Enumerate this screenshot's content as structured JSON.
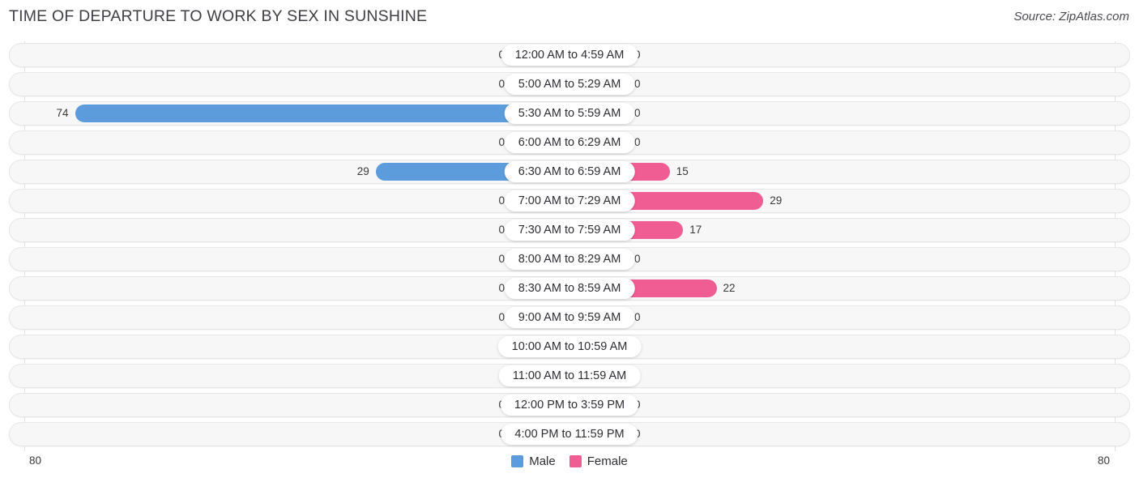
{
  "header": {
    "title": "TIME OF DEPARTURE TO WORK BY SEX IN SUNSHINE",
    "source": "Source: ZipAtlas.com"
  },
  "legend": {
    "male_label": "Male",
    "female_label": "Female",
    "male_color": "#5d9cdc",
    "female_color": "#ef5d93",
    "male_color_light": "#afcbee",
    "female_color_light": "#f9a8c3"
  },
  "axis": {
    "left_max_label": "80",
    "right_max_label": "80",
    "max": 80
  },
  "chart_data": {
    "type": "bar",
    "orientation": "horizontal-diverging",
    "title": "TIME OF DEPARTURE TO WORK BY SEX IN SUNSHINE",
    "xlabel": "",
    "ylabel": "",
    "xlim": [
      80,
      80
    ],
    "grid": false,
    "legend_position": "bottom-center",
    "categories": [
      "12:00 AM to 4:59 AM",
      "5:00 AM to 5:29 AM",
      "5:30 AM to 5:59 AM",
      "6:00 AM to 6:29 AM",
      "6:30 AM to 6:59 AM",
      "7:00 AM to 7:29 AM",
      "7:30 AM to 7:59 AM",
      "8:00 AM to 8:29 AM",
      "8:30 AM to 8:59 AM",
      "9:00 AM to 9:59 AM",
      "10:00 AM to 10:59 AM",
      "11:00 AM to 11:59 AM",
      "12:00 PM to 3:59 PM",
      "4:00 PM to 11:59 PM"
    ],
    "series": [
      {
        "name": "Male",
        "values": [
          0,
          0,
          74,
          0,
          29,
          0,
          0,
          0,
          0,
          0,
          0,
          0,
          0,
          0
        ]
      },
      {
        "name": "Female",
        "values": [
          0,
          0,
          0,
          0,
          15,
          29,
          17,
          0,
          22,
          0,
          0,
          0,
          0,
          0
        ]
      }
    ]
  },
  "rows": [
    {
      "label": "12:00 AM to 4:59 AM",
      "male": "0",
      "female": "0"
    },
    {
      "label": "5:00 AM to 5:29 AM",
      "male": "0",
      "female": "0"
    },
    {
      "label": "5:30 AM to 5:59 AM",
      "male": "74",
      "female": "0"
    },
    {
      "label": "6:00 AM to 6:29 AM",
      "male": "0",
      "female": "0"
    },
    {
      "label": "6:30 AM to 6:59 AM",
      "male": "29",
      "female": "15"
    },
    {
      "label": "7:00 AM to 7:29 AM",
      "male": "0",
      "female": "29"
    },
    {
      "label": "7:30 AM to 7:59 AM",
      "male": "0",
      "female": "17"
    },
    {
      "label": "8:00 AM to 8:29 AM",
      "male": "0",
      "female": "0"
    },
    {
      "label": "8:30 AM to 8:59 AM",
      "male": "0",
      "female": "22"
    },
    {
      "label": "9:00 AM to 9:59 AM",
      "male": "0",
      "female": "0"
    },
    {
      "label": "10:00 AM to 10:59 AM",
      "male": "0",
      "female": "0"
    },
    {
      "label": "11:00 AM to 11:59 AM",
      "male": "0",
      "female": "0"
    },
    {
      "label": "12:00 PM to 3:59 PM",
      "male": "0",
      "female": "0"
    },
    {
      "label": "4:00 PM to 11:59 PM",
      "male": "0",
      "female": "0"
    }
  ]
}
